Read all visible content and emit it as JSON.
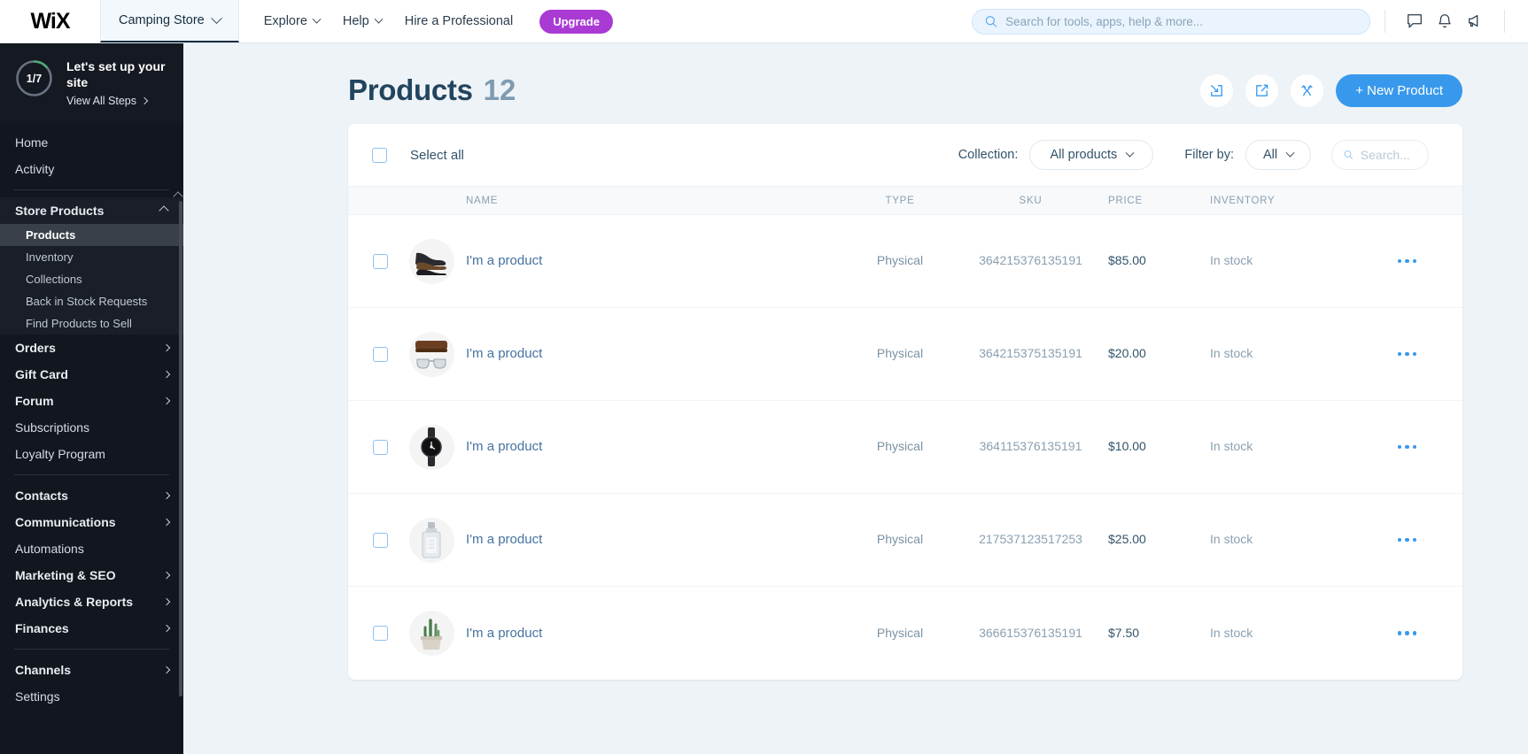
{
  "topbar": {
    "logo": "WiX",
    "site_name": "Camping Store",
    "nav": [
      {
        "label": "Explore",
        "has_caret": true
      },
      {
        "label": "Help",
        "has_caret": true
      },
      {
        "label": "Hire a Professional",
        "has_caret": false
      }
    ],
    "upgrade_label": "Upgrade",
    "search_placeholder": "Search for tools, apps, help & more...",
    "icons": [
      "chat-icon",
      "bell-icon",
      "megaphone-icon"
    ]
  },
  "sidebar": {
    "setup": {
      "progress_text": "1/7",
      "progress_current": 1,
      "progress_total": 7,
      "title": "Let's set up your site",
      "link": "View All Steps",
      "ring_color": "#4caf71"
    },
    "items": [
      {
        "label": "Home",
        "type": "item"
      },
      {
        "label": "Activity",
        "type": "item"
      },
      {
        "type": "separator"
      },
      {
        "label": "Store Products",
        "type": "group",
        "expanded": true,
        "bold": true
      },
      {
        "label": "Products",
        "type": "sub",
        "active": true
      },
      {
        "label": "Inventory",
        "type": "sub"
      },
      {
        "label": "Collections",
        "type": "sub"
      },
      {
        "label": "Back in Stock Requests",
        "type": "sub"
      },
      {
        "label": "Find Products to Sell",
        "type": "sub"
      },
      {
        "label": "Orders",
        "type": "item",
        "chevron": true,
        "bold": true
      },
      {
        "label": "Gift Card",
        "type": "item",
        "chevron": true,
        "bold": true
      },
      {
        "label": "Forum",
        "type": "item",
        "chevron": true,
        "bold": true
      },
      {
        "label": "Subscriptions",
        "type": "item"
      },
      {
        "label": "Loyalty Program",
        "type": "item"
      },
      {
        "type": "separator"
      },
      {
        "label": "Contacts",
        "type": "item",
        "chevron": true,
        "bold": true
      },
      {
        "label": "Communications",
        "type": "item",
        "chevron": true,
        "bold": true
      },
      {
        "label": "Automations",
        "type": "item"
      },
      {
        "label": "Marketing & SEO",
        "type": "item",
        "chevron": true,
        "bold": true
      },
      {
        "label": "Analytics & Reports",
        "type": "item",
        "chevron": true,
        "bold": true
      },
      {
        "label": "Finances",
        "type": "item",
        "chevron": true,
        "bold": true
      },
      {
        "type": "separator"
      },
      {
        "label": "Channels",
        "type": "item",
        "chevron": true,
        "bold": true
      },
      {
        "label": "Settings",
        "type": "item"
      }
    ]
  },
  "page": {
    "title": "Products",
    "count": "12",
    "actions": [
      {
        "name": "import-button",
        "icon": "import-icon"
      },
      {
        "name": "export-button",
        "icon": "export-icon"
      },
      {
        "name": "sort-button",
        "icon": "sort-arrows-icon"
      }
    ],
    "new_product_label": "+ New Product"
  },
  "toolbar": {
    "select_all_label": "Select all",
    "collection_label": "Collection:",
    "collection_value": "All products",
    "filter_label": "Filter by:",
    "filter_value": "All",
    "search_placeholder": "Search..."
  },
  "table": {
    "columns": [
      "NAME",
      "TYPE",
      "SKU",
      "PRICE",
      "INVENTORY"
    ],
    "rows": [
      {
        "name": "I'm a product",
        "type": "Physical",
        "sku": "364215376135191",
        "price": "$85.00",
        "inventory": "In stock",
        "thumb": "shoes"
      },
      {
        "name": "I'm a product",
        "type": "Physical",
        "sku": "364215375135191",
        "price": "$20.00",
        "inventory": "In stock",
        "thumb": "sunglasses"
      },
      {
        "name": "I'm a product",
        "type": "Physical",
        "sku": "364115376135191",
        "price": "$10.00",
        "inventory": "In stock",
        "thumb": "watch"
      },
      {
        "name": "I'm a product",
        "type": "Physical",
        "sku": "217537123517253",
        "price": "$25.00",
        "inventory": "In stock",
        "thumb": "perfume"
      },
      {
        "name": "I'm a product",
        "type": "Physical",
        "sku": "366615376135191",
        "price": "$7.50",
        "inventory": "In stock",
        "thumb": "cactus"
      }
    ]
  },
  "colors": {
    "accent": "#3899ec",
    "upgrade": "#aa3ad4",
    "sidebar_bg": "#12161f",
    "page_bg": "#eef3f7"
  }
}
